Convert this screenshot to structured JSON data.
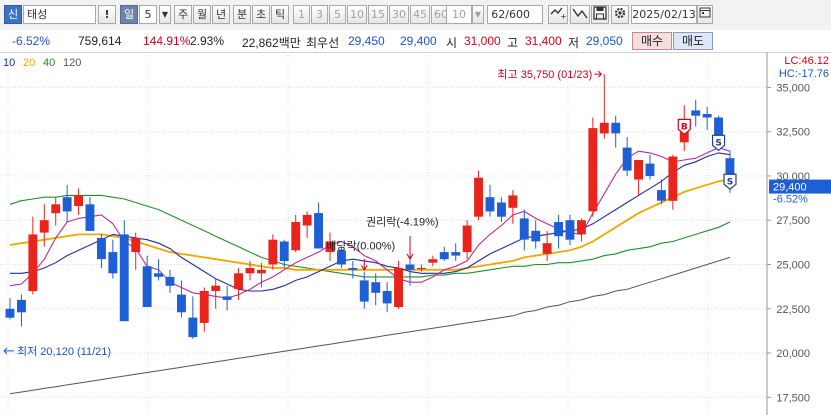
{
  "toolbar": {
    "stock_label": "태성",
    "exclaim": "!",
    "period_day": "일",
    "period_num": "5",
    "period_week": "주",
    "period_month": "월",
    "period_year": "년",
    "period_minute": "분",
    "period_second": "초",
    "period_tick": "틱",
    "intervals": [
      "1",
      "3",
      "5",
      "10",
      "15",
      "30",
      "45",
      "60"
    ],
    "interval_value": "10",
    "count": "62",
    "count_total": "/600",
    "date": "2025/02/13"
  },
  "info": {
    "change_pct": "-6.52%",
    "volume": "759,614",
    "volume_ratio": "144.91%",
    "turnover": "2.93%",
    "amount": "22,862백만",
    "best_label": "최우선",
    "best_ask": "29,450",
    "best_bid": "29,400",
    "open_label": "시",
    "open": "31,000",
    "high_label": "고",
    "high": "31,400",
    "low_label": "저",
    "low": "29,050",
    "buy_button": "매수",
    "sell_button": "매도"
  },
  "chart_data": {
    "type": "candlestick",
    "ma_legend": [
      "10",
      "20",
      "40",
      "120"
    ],
    "colors": {
      "up": "#e8241d",
      "down": "#1f5fd6",
      "ma5": "#c2289a",
      "ma10": "#1f2f9c",
      "ma20": "#f0a800",
      "ma40": "#1f8f2a",
      "ma120": "#555555"
    },
    "y_ticks": [
      17500,
      20000,
      22500,
      25000,
      27500,
      30000,
      32500,
      35000
    ],
    "ylim": [
      16500,
      37000
    ],
    "current_price": "29,400",
    "current_change": "-6.52%",
    "lc": "LC:46.12",
    "hc": "HC:-17.76",
    "annotations": {
      "high": "최고 35,750 (01/23)",
      "low": "최저 20,120 (11/21)",
      "rights": "권리락(-4.19%)",
      "dividend": "배당락(0.00%)"
    },
    "candles": [
      [
        22500,
        23100,
        21900,
        22000
      ],
      [
        23000,
        23300,
        21500,
        22300
      ],
      [
        23500,
        27700,
        23300,
        26700
      ],
      [
        26800,
        28400,
        26000,
        27500
      ],
      [
        27900,
        28800,
        27200,
        28400
      ],
      [
        28800,
        29500,
        27400,
        28000
      ],
      [
        28300,
        29300,
        27800,
        28900
      ],
      [
        28400,
        28800,
        26900,
        26900
      ],
      [
        26500,
        26700,
        24800,
        25300
      ],
      [
        25700,
        26400,
        24200,
        24500
      ],
      [
        26700,
        27500,
        21800,
        21800
      ],
      [
        25700,
        26800,
        24700,
        26500
      ],
      [
        24900,
        25500,
        22600,
        22600
      ],
      [
        24500,
        25300,
        24100,
        24300
      ],
      [
        24300,
        24700,
        23400,
        23800
      ],
      [
        23300,
        24100,
        22000,
        22300
      ],
      [
        22000,
        23200,
        20800,
        20900
      ],
      [
        21700,
        23700,
        21200,
        23500
      ],
      [
        23500,
        24200,
        22500,
        23800
      ],
      [
        23200,
        23800,
        22400,
        23000
      ],
      [
        23600,
        24800,
        23000,
        24500
      ],
      [
        24500,
        25200,
        24100,
        24800
      ],
      [
        24500,
        25100,
        23700,
        24700
      ],
      [
        25000,
        26700,
        24700,
        26400
      ],
      [
        26300,
        26400,
        24800,
        25200
      ],
      [
        25800,
        27800,
        25700,
        27400
      ],
      [
        27200,
        28000,
        26500,
        27800
      ],
      [
        27900,
        28500,
        25900,
        25900
      ],
      [
        25700,
        26800,
        25200,
        26300
      ],
      [
        25800,
        26000,
        24800,
        25000
      ],
      [
        24800,
        25200,
        24200,
        24700
      ],
      [
        24100,
        24600,
        22500,
        22900
      ],
      [
        24000,
        24500,
        22700,
        23400
      ],
      [
        23500,
        24000,
        22300,
        22800
      ],
      [
        22600,
        25200,
        22500,
        24800
      ],
      [
        25000,
        25500,
        23800,
        24700
      ],
      [
        24800,
        25000,
        24600,
        24800
      ],
      [
        25100,
        25500,
        24900,
        25300
      ],
      [
        25700,
        26000,
        25200,
        25300
      ],
      [
        25700,
        26200,
        25200,
        25500
      ],
      [
        25700,
        27500,
        25300,
        27200
      ],
      [
        27700,
        30300,
        27500,
        29900
      ],
      [
        28800,
        29500,
        27700,
        28000
      ],
      [
        28500,
        28800,
        27400,
        27700
      ],
      [
        28200,
        29200,
        27300,
        28900
      ],
      [
        27600,
        28100,
        25800,
        26400
      ],
      [
        26900,
        27500,
        25900,
        26300
      ],
      [
        25600,
        26900,
        25200,
        26200
      ],
      [
        27400,
        27800,
        25900,
        26600
      ],
      [
        27500,
        27800,
        26100,
        26400
      ],
      [
        26700,
        27600,
        26300,
        27500
      ],
      [
        28000,
        33300,
        27700,
        32700
      ],
      [
        32400,
        35750,
        32100,
        33000
      ],
      [
        33000,
        33400,
        31600,
        32400
      ],
      [
        31600,
        32200,
        30000,
        30300
      ],
      [
        29800,
        30900,
        28900,
        30900
      ],
      [
        30700,
        31200,
        29800,
        30000
      ],
      [
        29200,
        29800,
        28400,
        28600
      ],
      [
        28600,
        31200,
        28100,
        31100
      ],
      [
        31900,
        34000,
        31400,
        32700
      ],
      [
        33700,
        34300,
        32800,
        33400
      ],
      [
        33500,
        33900,
        32600,
        33300
      ],
      [
        33300,
        33400,
        31700,
        32000
      ],
      [
        31000,
        31400,
        29050,
        29400
      ]
    ],
    "ma5": [
      23800,
      23900,
      24500,
      25300,
      26500,
      27400,
      27600,
      27700,
      27800,
      27300,
      26300,
      25900,
      24900,
      24700,
      24000,
      23700,
      23400,
      23300,
      23200,
      23100,
      23300,
      23600,
      24000,
      24300,
      24700,
      25100,
      25400,
      25700,
      26100,
      26300,
      26000,
      25500,
      25200,
      24700,
      24200,
      24000,
      24000,
      24300,
      24700,
      24900,
      25200,
      26100,
      26700,
      27200,
      27800,
      28000,
      27600,
      27300,
      27000,
      26800,
      26700,
      27900,
      29000,
      30100,
      31000,
      31400,
      31300,
      31100,
      30800,
      30900,
      31000,
      31300,
      31600,
      31400
    ],
    "ma10": [
      24500,
      24500,
      24600,
      24800,
      25100,
      25500,
      25800,
      26100,
      26400,
      26700,
      26600,
      26500,
      26400,
      26200,
      25900,
      25400,
      25000,
      24600,
      24200,
      23900,
      23600,
      23500,
      23500,
      23600,
      23800,
      24100,
      24300,
      24600,
      24900,
      25200,
      25300,
      25200,
      25100,
      24900,
      24800,
      24600,
      24500,
      24500,
      24500,
      24600,
      24800,
      25200,
      25600,
      25900,
      26200,
      26500,
      26600,
      26700,
      26800,
      26900,
      27000,
      27300,
      27700,
      28100,
      28500,
      28900,
      29300,
      29700,
      30200,
      30600,
      30800,
      31100,
      31300,
      31200
    ],
    "ma20": [
      26100,
      26200,
      26300,
      26400,
      26500,
      26600,
      26700,
      26700,
      26700,
      26600,
      26500,
      26300,
      26100,
      25900,
      25700,
      25600,
      25500,
      25400,
      25300,
      25200,
      25100,
      25000,
      24900,
      24800,
      24800,
      24700,
      24700,
      24700,
      24700,
      24700,
      24700,
      24700,
      24700,
      24700,
      24700,
      24700,
      24700,
      24700,
      24700,
      24700,
      24800,
      24900,
      25000,
      25100,
      25200,
      25400,
      25500,
      25600,
      25700,
      25800,
      26000,
      26300,
      26700,
      27100,
      27500,
      27900,
      28200,
      28500,
      28800,
      29100,
      29300,
      29500,
      29700,
      29800
    ],
    "ma40": [
      28400,
      28600,
      28700,
      28800,
      28800,
      28900,
      28900,
      28900,
      28900,
      28800,
      28700,
      28500,
      28300,
      28100,
      27800,
      27500,
      27200,
      26900,
      26600,
      26300,
      26000,
      25700,
      25400,
      25200,
      25000,
      24900,
      24800,
      24700,
      24600,
      24500,
      24400,
      24300,
      24300,
      24300,
      24300,
      24300,
      24300,
      24400,
      24400,
      24500,
      24500,
      24600,
      24700,
      24800,
      24900,
      24900,
      25000,
      25000,
      25100,
      25100,
      25200,
      25300,
      25500,
      25600,
      25800,
      25900,
      26000,
      26200,
      26300,
      26500,
      26700,
      26900,
      27100,
      27400
    ],
    "ma120": [
      17700,
      17800,
      17900,
      18000,
      18100,
      18200,
      18300,
      18400,
      18500,
      18600,
      18700,
      18800,
      18900,
      19000,
      19100,
      19200,
      19300,
      19400,
      19500,
      19600,
      19700,
      19800,
      19900,
      20000,
      20100,
      20200,
      20300,
      20400,
      20500,
      20600,
      20700,
      20800,
      20900,
      21000,
      21100,
      21200,
      21300,
      21400,
      21500,
      21600,
      21700,
      21800,
      21900,
      22000,
      22100,
      22300,
      22400,
      22600,
      22700,
      22900,
      23000,
      23200,
      23300,
      23500,
      23600,
      23800,
      24000,
      24200,
      24400,
      24600,
      24800,
      25000,
      25200,
      25400
    ]
  }
}
